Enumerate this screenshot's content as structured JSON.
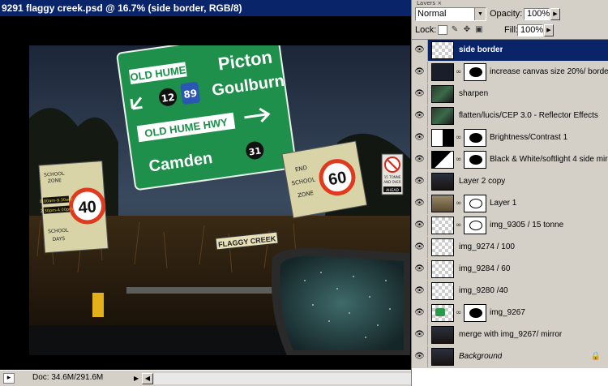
{
  "document": {
    "title": "9291 flaggy creek.psd @ 16.7% (side border, RGB/8)",
    "status_doc": "Doc: 34.6M/291.6M"
  },
  "photo": {
    "sign_top_line": "OLD HUME",
    "sign_route_12": "12",
    "sign_route_89": "89",
    "sign_place_1": "Picton",
    "sign_place_2": "Goulburn",
    "sign_hwy": "OLD HUME HWY",
    "sign_route_31": "31",
    "sign_camden": "Camden",
    "speed_left": "40",
    "school_zone_left": [
      "SCHOOL",
      "ZONE",
      "8.00am-9.30am",
      "2.30pm-4.00pm",
      "SCHOOL",
      "DAYS"
    ],
    "speed_right": "60",
    "school_zone_right": [
      "END",
      "SCHOOL",
      "ZONE"
    ],
    "tonne_sign": [
      "15 TONNE",
      "AND OVER",
      "AHEAD"
    ],
    "creek_sign": "FLAGGY CREEK"
  },
  "layers_panel": {
    "tab_label": "Layers ×",
    "blend_mode": "Normal",
    "opacity_label": "Opacity:",
    "opacity_value": "100%",
    "lock_label": "Lock:",
    "fill_label": "Fill:",
    "fill_value": "100%",
    "layers": [
      {
        "name": "side border",
        "selected": true,
        "thumb": "transparent",
        "mask": false
      },
      {
        "name": "increase canvas size 20%/ border",
        "selected": false,
        "thumb": "dark",
        "mask": true
      },
      {
        "name": "sharpen",
        "selected": false,
        "thumb": "photo",
        "mask": false
      },
      {
        "name": "flatten/lucis/CEP 3.0 - Reflector Effects",
        "selected": false,
        "thumb": "photo",
        "mask": false
      },
      {
        "name": "Brightness/Contrast 1",
        "selected": false,
        "thumb": "adjust",
        "mask": true
      },
      {
        "name": "Black & White/softlight 4 side mirror",
        "selected": false,
        "thumb": "bw",
        "mask": true
      },
      {
        "name": "Layer 2 copy",
        "selected": false,
        "thumb": "photo-dark",
        "mask": false
      },
      {
        "name": "Layer 1",
        "selected": false,
        "thumb": "photo-tan",
        "mask": true
      },
      {
        "name": "img_9305 / 15 tonne",
        "selected": false,
        "thumb": "transparent",
        "mask": true
      },
      {
        "name": "img_9274 / 100",
        "selected": false,
        "thumb": "transparent",
        "mask": false
      },
      {
        "name": "img_9284 / 60",
        "selected": false,
        "thumb": "transparent",
        "mask": false
      },
      {
        "name": "img_9280 /40",
        "selected": false,
        "thumb": "transparent",
        "mask": false
      },
      {
        "name": "img_9267",
        "selected": false,
        "thumb": "green",
        "mask": true
      },
      {
        "name": "merge with img_9267/ mirror",
        "selected": false,
        "thumb": "photo-dark",
        "mask": false
      },
      {
        "name": "Background",
        "selected": false,
        "thumb": "photo-dark",
        "mask": false,
        "italic": true,
        "locked": true
      }
    ]
  }
}
